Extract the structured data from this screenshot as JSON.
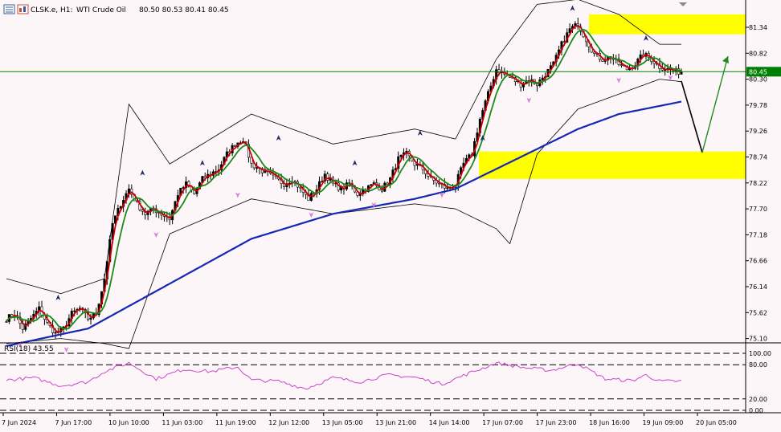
{
  "header": {
    "symbol": "CLSK.e, H1:",
    "description": "WTI Crude Oil",
    "ohlc": "80.50 80.53 80.41 80.45",
    "icons": [
      "window-icon",
      "chart-icon"
    ]
  },
  "rsi": {
    "label": "RSI(18) 43.55",
    "levels": [
      "100.00",
      "80.00",
      "20.00",
      "0.00"
    ]
  },
  "colors": {
    "background": "#fdf6f8",
    "bull_candle": "#000000",
    "bear_candle": "#cc0000",
    "fast_ma": "#cc0000",
    "slow_ma": "#1a8a1a",
    "long_ma": "#1428b4",
    "bollinger": "#000000",
    "zone": "#ffff00",
    "current_price_line": "#008000",
    "rsi": "#cc44cc",
    "fractal_up": "#1f2a6e",
    "fractal_down": "#d67fe0",
    "projection_down": "#000000",
    "projection_up": "#228b22"
  },
  "chart_data": {
    "type": "candlestick",
    "symbol": "CLSK.e",
    "timeframe": "H1",
    "y_ticks": [
      "81.34",
      "80.82",
      "80.30",
      "79.78",
      "79.26",
      "78.74",
      "78.22",
      "77.70",
      "77.18",
      "76.66",
      "76.14",
      "75.62",
      "75.10"
    ],
    "ylim": [
      74.95,
      81.75
    ],
    "x_ticks": [
      "7 Jun 2024",
      "7 Jun 17:00",
      "10 Jun 10:00",
      "11 Jun 03:00",
      "11 Jun 19:00",
      "12 Jun 12:00",
      "13 Jun 05:00",
      "13 Jun 21:00",
      "14 Jun 14:00",
      "17 Jun 07:00",
      "17 Jun 23:00",
      "18 Jun 16:00",
      "19 Jun 09:00",
      "20 Jun 05:00"
    ],
    "current_price": "80.45",
    "zones": [
      {
        "from": 81.2,
        "to": 81.6
      },
      {
        "from": 78.3,
        "to": 78.85
      }
    ],
    "close_anchors": [
      [
        0,
        75.5
      ],
      [
        3,
        75.6
      ],
      [
        6,
        75.3
      ],
      [
        9,
        75.5
      ],
      [
        12,
        75.7
      ],
      [
        15,
        75.4
      ],
      [
        18,
        75.2
      ],
      [
        21,
        75.3
      ],
      [
        24,
        75.6
      ],
      [
        27,
        75.7
      ],
      [
        30,
        75.5
      ],
      [
        33,
        75.6
      ],
      [
        36,
        76.3
      ],
      [
        39,
        77.4
      ],
      [
        42,
        77.8
      ],
      [
        45,
        78.1
      ],
      [
        48,
        77.8
      ],
      [
        51,
        77.6
      ],
      [
        54,
        77.7
      ],
      [
        57,
        77.6
      ],
      [
        60,
        77.5
      ],
      [
        63,
        78.0
      ],
      [
        66,
        78.2
      ],
      [
        69,
        78.0
      ],
      [
        72,
        78.3
      ],
      [
        75,
        78.4
      ],
      [
        78,
        78.5
      ],
      [
        81,
        78.8
      ],
      [
        84,
        79.0
      ],
      [
        87,
        79.1
      ],
      [
        90,
        78.6
      ],
      [
        93,
        78.5
      ],
      [
        96,
        78.4
      ],
      [
        99,
        78.3
      ],
      [
        102,
        78.2
      ],
      [
        105,
        78.3
      ],
      [
        108,
        78.1
      ],
      [
        111,
        77.9
      ],
      [
        114,
        78.1
      ],
      [
        117,
        78.4
      ],
      [
        120,
        78.2
      ],
      [
        123,
        78.1
      ],
      [
        126,
        78.2
      ],
      [
        129,
        78.0
      ],
      [
        132,
        78.1
      ],
      [
        135,
        78.2
      ],
      [
        138,
        78.1
      ],
      [
        141,
        78.3
      ],
      [
        144,
        78.7
      ],
      [
        147,
        78.8
      ],
      [
        150,
        78.6
      ],
      [
        153,
        78.5
      ],
      [
        156,
        78.3
      ],
      [
        159,
        78.2
      ],
      [
        162,
        78.1
      ],
      [
        165,
        78.2
      ],
      [
        168,
        78.6
      ],
      [
        171,
        78.8
      ],
      [
        174,
        79.5
      ],
      [
        177,
        80.0
      ],
      [
        180,
        80.5
      ],
      [
        183,
        80.4
      ],
      [
        186,
        80.3
      ],
      [
        189,
        80.2
      ],
      [
        192,
        80.3
      ],
      [
        195,
        80.2
      ],
      [
        198,
        80.4
      ],
      [
        201,
        80.6
      ],
      [
        204,
        81.0
      ],
      [
        207,
        81.3
      ],
      [
        210,
        81.4
      ],
      [
        213,
        81.1
      ],
      [
        216,
        80.8
      ],
      [
        219,
        80.7
      ],
      [
        222,
        80.75
      ],
      [
        225,
        80.6
      ],
      [
        228,
        80.5
      ],
      [
        231,
        80.6
      ],
      [
        234,
        80.8
      ],
      [
        237,
        80.7
      ],
      [
        240,
        80.55
      ],
      [
        243,
        80.5
      ],
      [
        246,
        80.45
      ],
      [
        248,
        80.45
      ]
    ],
    "bollinger_upper_anchors": [
      [
        0,
        76.3
      ],
      [
        20,
        76.0
      ],
      [
        36,
        76.3
      ],
      [
        45,
        79.8
      ],
      [
        60,
        78.6
      ],
      [
        90,
        79.6
      ],
      [
        120,
        79.0
      ],
      [
        150,
        79.3
      ],
      [
        165,
        79.1
      ],
      [
        180,
        80.7
      ],
      [
        195,
        81.8
      ],
      [
        210,
        81.9
      ],
      [
        225,
        81.6
      ],
      [
        240,
        81.0
      ],
      [
        248,
        81.0
      ]
    ],
    "bollinger_lower_anchors": [
      [
        0,
        75.0
      ],
      [
        20,
        75.1
      ],
      [
        36,
        75.0
      ],
      [
        45,
        74.9
      ],
      [
        60,
        77.2
      ],
      [
        90,
        77.9
      ],
      [
        120,
        77.6
      ],
      [
        150,
        77.8
      ],
      [
        165,
        77.7
      ],
      [
        180,
        77.3
      ],
      [
        185,
        77.0
      ],
      [
        195,
        78.8
      ],
      [
        210,
        79.7
      ],
      [
        225,
        80.0
      ],
      [
        240,
        80.3
      ],
      [
        248,
        80.25
      ]
    ],
    "long_ma_anchors": [
      [
        0,
        74.95
      ],
      [
        30,
        75.3
      ],
      [
        60,
        76.2
      ],
      [
        90,
        77.1
      ],
      [
        120,
        77.6
      ],
      [
        150,
        77.9
      ],
      [
        165,
        78.1
      ],
      [
        180,
        78.5
      ],
      [
        195,
        78.9
      ],
      [
        210,
        79.3
      ],
      [
        225,
        79.6
      ],
      [
        248,
        79.85
      ]
    ],
    "fractals_up": [
      [
        19,
        75.9
      ],
      [
        50,
        78.4
      ],
      [
        72,
        78.6
      ],
      [
        100,
        79.1
      ],
      [
        128,
        78.6
      ],
      [
        152,
        79.2
      ],
      [
        175,
        79.1
      ],
      [
        208,
        81.7
      ],
      [
        235,
        81.1
      ]
    ],
    "fractals_down": [
      [
        5,
        75.0
      ],
      [
        22,
        74.9
      ],
      [
        55,
        77.2
      ],
      [
        85,
        78.0
      ],
      [
        112,
        77.6
      ],
      [
        135,
        77.8
      ],
      [
        160,
        78.0
      ],
      [
        192,
        79.9
      ],
      [
        225,
        80.3
      ],
      [
        244,
        80.35
      ]
    ],
    "rsi_anchors": [
      [
        0,
        53
      ],
      [
        10,
        57
      ],
      [
        20,
        43
      ],
      [
        30,
        50
      ],
      [
        36,
        68
      ],
      [
        45,
        83
      ],
      [
        55,
        55
      ],
      [
        65,
        72
      ],
      [
        75,
        68
      ],
      [
        85,
        76
      ],
      [
        90,
        53
      ],
      [
        100,
        51
      ],
      [
        110,
        38
      ],
      [
        120,
        57
      ],
      [
        130,
        50
      ],
      [
        140,
        62
      ],
      [
        150,
        58
      ],
      [
        160,
        46
      ],
      [
        170,
        65
      ],
      [
        180,
        83
      ],
      [
        190,
        75
      ],
      [
        200,
        70
      ],
      [
        210,
        82
      ],
      [
        220,
        55
      ],
      [
        230,
        52
      ],
      [
        235,
        62
      ],
      [
        240,
        51
      ],
      [
        248,
        51
      ]
    ],
    "projection_down": [
      [
        848,
        101
      ],
      [
        874,
        190
      ]
    ],
    "projection_up": [
      [
        874,
        190
      ],
      [
        906,
        70
      ]
    ]
  }
}
